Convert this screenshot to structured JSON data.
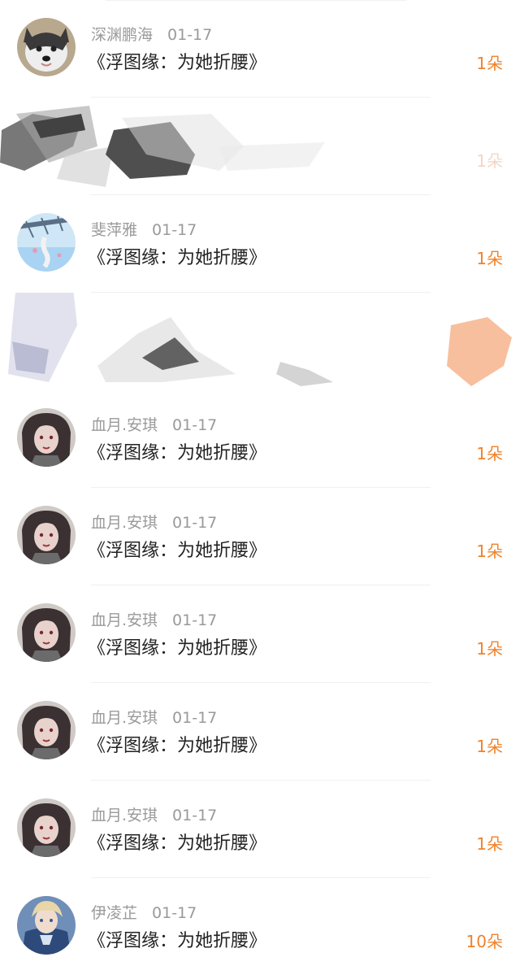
{
  "gift_list": {
    "items": [
      {
        "name": "深渊鹏海",
        "date": "01-17",
        "book": "《浮图缘：为她折腰》",
        "count": "1朵",
        "avatar": "husky-dog-avatar"
      },
      {
        "name": "",
        "date": "",
        "book": "",
        "count": "1朵",
        "redacted": true
      },
      {
        "name": "斐萍雅",
        "date": "01-17",
        "book": "《浮图缘：为她折腰》",
        "count": "1朵",
        "avatar": "sky-scene-avatar"
      },
      {
        "name": "",
        "date": "",
        "book": "",
        "count": "",
        "redacted": true
      },
      {
        "name": "血月.安琪",
        "date": "01-17",
        "book": "《浮图缘：为她折腰》",
        "count": "1朵",
        "avatar": "anime-girl-avatar"
      },
      {
        "name": "血月.安琪",
        "date": "01-17",
        "book": "《浮图缘：为她折腰》",
        "count": "1朵",
        "avatar": "anime-girl-avatar"
      },
      {
        "name": "血月.安琪",
        "date": "01-17",
        "book": "《浮图缘：为她折腰》",
        "count": "1朵",
        "avatar": "anime-girl-avatar"
      },
      {
        "name": "血月.安琪",
        "date": "01-17",
        "book": "《浮图缘：为她折腰》",
        "count": "1朵",
        "avatar": "anime-girl-avatar"
      },
      {
        "name": "血月.安琪",
        "date": "01-17",
        "book": "《浮图缘：为她折腰》",
        "count": "1朵",
        "avatar": "anime-girl-avatar"
      },
      {
        "name": "伊凌芷",
        "date": "01-17",
        "book": "《浮图缘：为她折腰》",
        "count": "10朵",
        "avatar": "anime-boy-avatar"
      }
    ]
  },
  "colors": {
    "count_accent": "#f0822a",
    "meta_gray": "#9a9a9a",
    "title_text": "#222222"
  }
}
